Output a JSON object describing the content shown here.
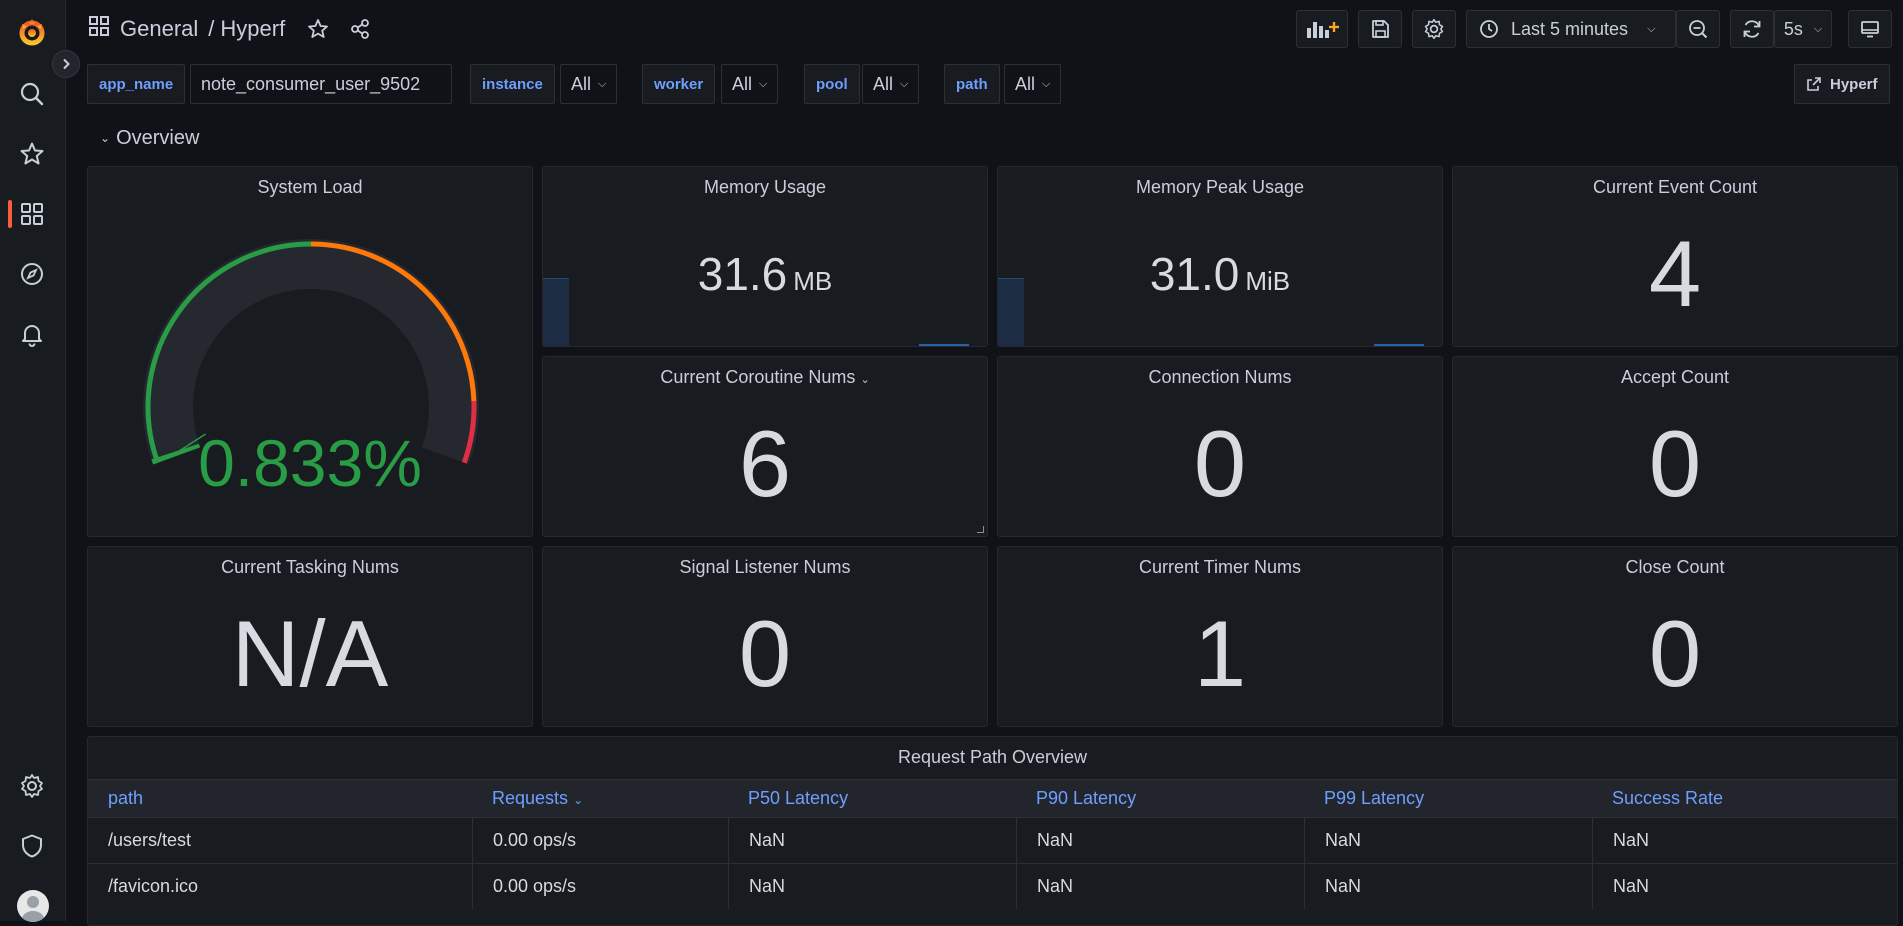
{
  "header": {
    "breadcrumb_root": "General",
    "breadcrumb_sep": "/",
    "dashboard_title": "Hyperf",
    "time_range": "Last 5 minutes",
    "refresh_interval": "5s",
    "link_label": "Hyperf"
  },
  "variables": [
    {
      "label": "app_name",
      "value": "note_consumer_user_9502"
    },
    {
      "label": "instance",
      "value": "All"
    },
    {
      "label": "worker",
      "value": "All"
    },
    {
      "label": "pool",
      "value": "All"
    },
    {
      "label": "path",
      "value": "All"
    }
  ],
  "row": {
    "title": "Overview"
  },
  "panels": {
    "system_load": {
      "title": "System Load",
      "value": "0.833%",
      "level_percent": 0.833,
      "min": 0,
      "max": 100,
      "color": "#299c46"
    },
    "memory_usage": {
      "title": "Memory Usage",
      "value": "31.6",
      "unit": "MB"
    },
    "memory_peak": {
      "title": "Memory Peak Usage",
      "value": "31.0",
      "unit": "MiB"
    },
    "event_count": {
      "title": "Current Event Count",
      "value": "4"
    },
    "coroutine": {
      "title": "Current Coroutine Nums",
      "value": "6"
    },
    "connection": {
      "title": "Connection Nums",
      "value": "0"
    },
    "accept": {
      "title": "Accept Count",
      "value": "0"
    },
    "tasking": {
      "title": "Current Tasking Nums",
      "value": "N/A"
    },
    "signal": {
      "title": "Signal Listener Nums",
      "value": "0"
    },
    "timer": {
      "title": "Current Timer Nums",
      "value": "1"
    },
    "close": {
      "title": "Close Count",
      "value": "0"
    }
  },
  "table": {
    "title": "Request Path Overview",
    "columns": [
      "path",
      "Requests",
      "P50 Latency",
      "P90 Latency",
      "P99 Latency",
      "Success Rate"
    ],
    "rows": [
      [
        "/users/test",
        "0.00 ops/s",
        "NaN",
        "NaN",
        "NaN",
        "NaN"
      ],
      [
        "/favicon.ico",
        "0.00 ops/s",
        "NaN",
        "NaN",
        "NaN",
        "NaN"
      ]
    ]
  },
  "colors": {
    "accent_blue": "#6e9fff",
    "gauge_green": "#299c46",
    "gauge_orange": "#ff780a",
    "gauge_red": "#e02f44",
    "active_orange": "#f55f3e"
  },
  "icons": [
    "grafana-logo-icon",
    "search-icon",
    "star-icon",
    "dashboards-icon",
    "explore-icon",
    "bell-icon",
    "gear-icon",
    "shield-icon",
    "avatar",
    "grid-icon",
    "share-icon",
    "add-panel-icon",
    "save-icon",
    "clock-icon",
    "zoom-out-icon",
    "refresh-icon",
    "tv-mode-icon",
    "external-link-icon"
  ]
}
